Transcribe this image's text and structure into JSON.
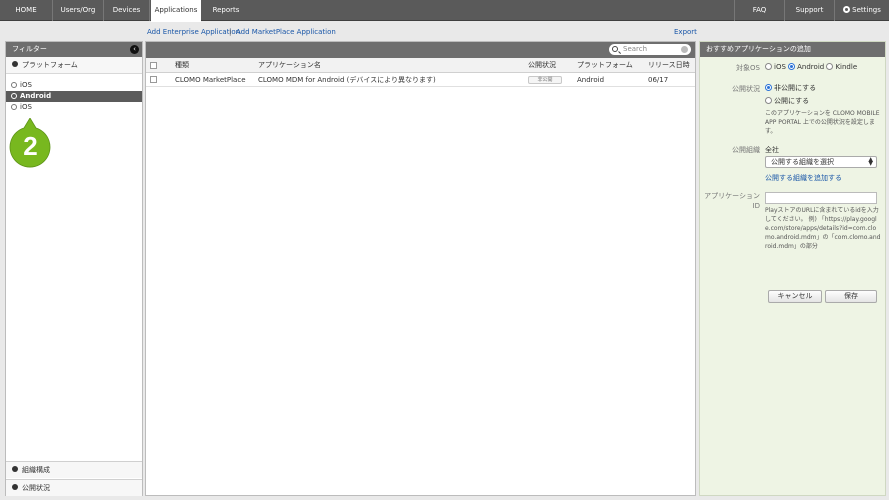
{
  "nav": {
    "home": "HOME",
    "users_org": "Users/Org",
    "devices": "Devices",
    "applications": "Applications",
    "reports": "Reports",
    "faq": "FAQ",
    "support": "Support",
    "settings": "Settings"
  },
  "links": {
    "add_enterprise": "Add Enterprise Application",
    "separator": "|",
    "add_marketplace": "Add MarketPlace Application",
    "export": "Export"
  },
  "sidebar": {
    "title": "フィルター",
    "platform_section": "プラットフォーム",
    "options": [
      "iOS",
      "Android",
      "iOS"
    ],
    "org_section": "組織構成",
    "status_section": "公開状況"
  },
  "badge": {
    "number": "2",
    "color": "#78b81f"
  },
  "table": {
    "search_placeholder": "Search",
    "headers": {
      "type": "種類",
      "app_name": "アプリケーション名",
      "status": "公開状況",
      "platform": "プラットフォーム",
      "release_date": "リリース日時"
    },
    "rows": [
      {
        "type": "CLOMO MarketPlace",
        "app_name": "CLOMO MDM for Android (デバイスにより異なります)",
        "status": "非公開",
        "platform": "Android",
        "release_date": "06/17"
      }
    ]
  },
  "panel": {
    "title": "おすすめアプリケーションの追加",
    "target_os_label": "対象OS",
    "os_options": [
      "iOS",
      "Android",
      "Kindle"
    ],
    "os_selected": "Android",
    "status_label": "公開状況",
    "status_options": [
      "非公開にする",
      "公開にする"
    ],
    "status_help": "このアプリケーションを CLOMO MOBILE APP PORTAL 上での公開状況を設定します。",
    "org_label": "公開組織",
    "org_value": "全社",
    "org_select": "公開する組織を選択",
    "org_add_link": "公開する組織を追加する",
    "app_id_label": "アプリケーション ID",
    "app_id_help": "PlayストアのURLに含まれているidを入力してください。 例) 「https://play.google.com/store/apps/details?id=com.clomo.android.mdm」の「com.clomo.android.mdm」の部分",
    "cancel": "キャンセル",
    "save": "保存"
  }
}
